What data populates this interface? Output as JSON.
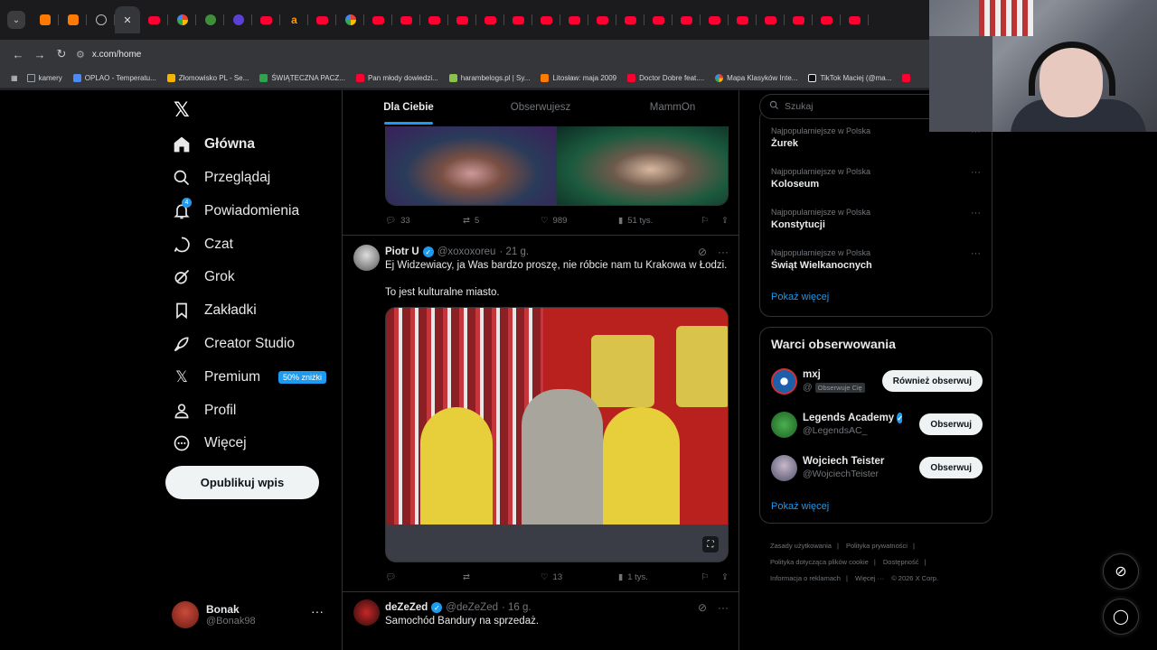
{
  "browser": {
    "url": "x.com/home",
    "bookmarks": [
      {
        "label": "kamery",
        "color": "#9aa0a6"
      },
      {
        "label": "OPLAO - Temperatu...",
        "color": "#4c8bf5"
      },
      {
        "label": "Złomowisko PL - Se...",
        "color": "#f4b400"
      },
      {
        "label": "ŚWIĄTECZNA PACZ...",
        "color": "#2ea44f"
      },
      {
        "label": "Pan młody dowiedzi...",
        "color": "#ff0033"
      },
      {
        "label": "harambelogs.pl | Sy...",
        "color": "#8bc34a"
      },
      {
        "label": "Litosław: maja 2009",
        "color": "#ff7a00"
      },
      {
        "label": "Doctor Dobre feat....",
        "color": "#ff0033"
      },
      {
        "label": "Mapa Klasyków Inte...",
        "color": "#9aa0a6"
      },
      {
        "label": "TikTok Maciej (@ma...",
        "color": "#e7e9ea"
      }
    ]
  },
  "nav": {
    "items": [
      {
        "label": "Główna",
        "icon": "home-icon"
      },
      {
        "label": "Przeglądaj",
        "icon": "search-icon"
      },
      {
        "label": "Powiadomienia",
        "icon": "bell-icon",
        "badge": "4"
      },
      {
        "label": "Czat",
        "icon": "chat-icon"
      },
      {
        "label": "Grok",
        "icon": "grok-icon"
      },
      {
        "label": "Zakładki",
        "icon": "bookmark-icon"
      },
      {
        "label": "Creator Studio",
        "icon": "rocket-icon"
      },
      {
        "label": "Premium",
        "icon": "x-icon",
        "badge": "50% zniżki"
      },
      {
        "label": "Profil",
        "icon": "person-icon"
      },
      {
        "label": "Więcej",
        "icon": "more-circle-icon"
      }
    ],
    "post_button": "Opublikuj wpis",
    "account": {
      "name": "Bonak",
      "handle": "@Bonak98"
    }
  },
  "feed": {
    "tabs": [
      "Dla Ciebie",
      "Obserwujesz",
      "MammOn"
    ],
    "first_tweet_actions": {
      "replies": "33",
      "reposts": "5",
      "likes": "989",
      "views": "51 tys."
    },
    "tweet2": {
      "name": "Piotr U",
      "handle": "@xoxoxoreu",
      "time": "· 21 g.",
      "text1": "Ej Widzewiacy, ja Was bardzo proszę, nie róbcie nam tu Krakowa w Łodzi.",
      "text2": "To jest kulturalne miasto.",
      "actions": {
        "replies": "",
        "reposts": "",
        "likes": "13",
        "views": "1 tys."
      }
    },
    "tweet3": {
      "name": "deZeZed",
      "handle": "@deZeZed",
      "time": "· 16 g.",
      "text": "Samochód Bandury na sprzedaż."
    }
  },
  "sidebar": {
    "search_placeholder": "Szukaj",
    "trends": [
      {
        "context": "Najpopularniejsze w Polska",
        "title": "Żurek"
      },
      {
        "context": "Najpopularniejsze w Polska",
        "title": "Koloseum"
      },
      {
        "context": "Najpopularniejsze w Polska",
        "title": "Konstytucji"
      },
      {
        "context": "Najpopularniejsze w Polska",
        "title": "Świąt Wielkanocnych"
      }
    ],
    "show_more": "Pokaż więcej",
    "who_to_follow_title": "Warci obserwowania",
    "who_to_follow": [
      {
        "name": "mxj",
        "handle": "@",
        "follows_you": "Obserwuje Cię",
        "button": "Również obserwuj",
        "avatar_color": "#1d5fa8"
      },
      {
        "name": "Legends Academy",
        "handle": "@LegendsAC_",
        "follows_you": "",
        "button": "Obserwuj",
        "avatar_color": "#2e7d32"
      },
      {
        "name": "Wojciech Teister",
        "handle": "@WojciechTeister",
        "follows_you": "",
        "button": "Obserwuj",
        "avatar_color": "#5b5f7a"
      }
    ],
    "who_show_more": "Pokaż więcej",
    "footer": [
      "Zasady użytkowania",
      "|",
      "Polityka prywatności",
      "|",
      "Polityka dotycząca plików cookie",
      "|",
      "Dostępność",
      "|",
      "Informacja o reklamach",
      "|",
      "Więcej ···",
      "© 2026 X Corp."
    ]
  },
  "colors": {
    "accent": "#1d9bf0",
    "background": "#000000",
    "border": "#2f3336"
  }
}
